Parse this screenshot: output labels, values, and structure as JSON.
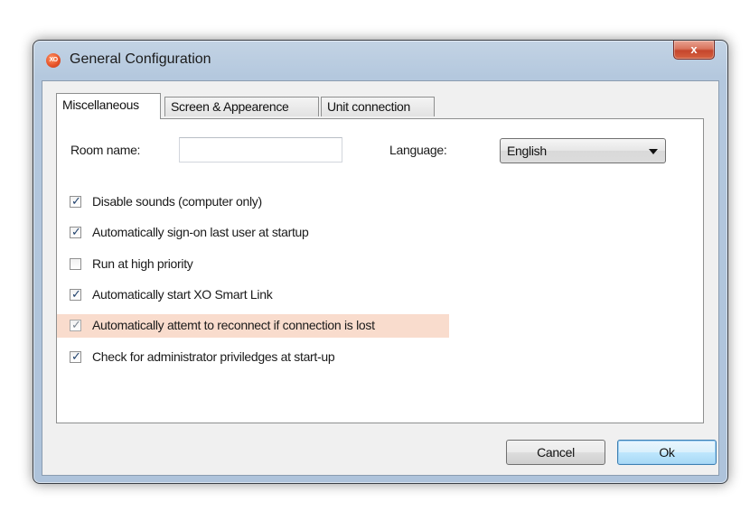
{
  "window": {
    "title": "General Configuration",
    "icon": "xo-app-icon",
    "icon_text": "XO",
    "close_glyph": "x"
  },
  "tabs": [
    {
      "label": "Miscellaneous",
      "active": true
    },
    {
      "label": "Screen & Appearence",
      "active": false
    },
    {
      "label": "Unit connection",
      "active": false
    }
  ],
  "form": {
    "room_name_label": "Room name:",
    "room_name_value": "",
    "room_name_placeholder": "",
    "language_label": "Language:",
    "language_value": "English"
  },
  "options": [
    {
      "label": "Disable sounds (computer only)",
      "checked": true
    },
    {
      "label": "Automatically sign-on last user at startup",
      "checked": true
    },
    {
      "label": "Run at high priority",
      "checked": false
    },
    {
      "label": "Automatically start XO Smart Link",
      "checked": true
    },
    {
      "label": "Automatically attemt to reconnect if connection is lost",
      "checked": true,
      "highlighted": true
    },
    {
      "label": "Check for administrator priviledges at start-up",
      "checked": true
    }
  ],
  "buttons": {
    "cancel_label": "Cancel",
    "ok_label": "Ok"
  },
  "colors": {
    "highlight": "#f9dccd",
    "close_button": "#c5462d",
    "default_button_border": "#3c7fb1"
  }
}
